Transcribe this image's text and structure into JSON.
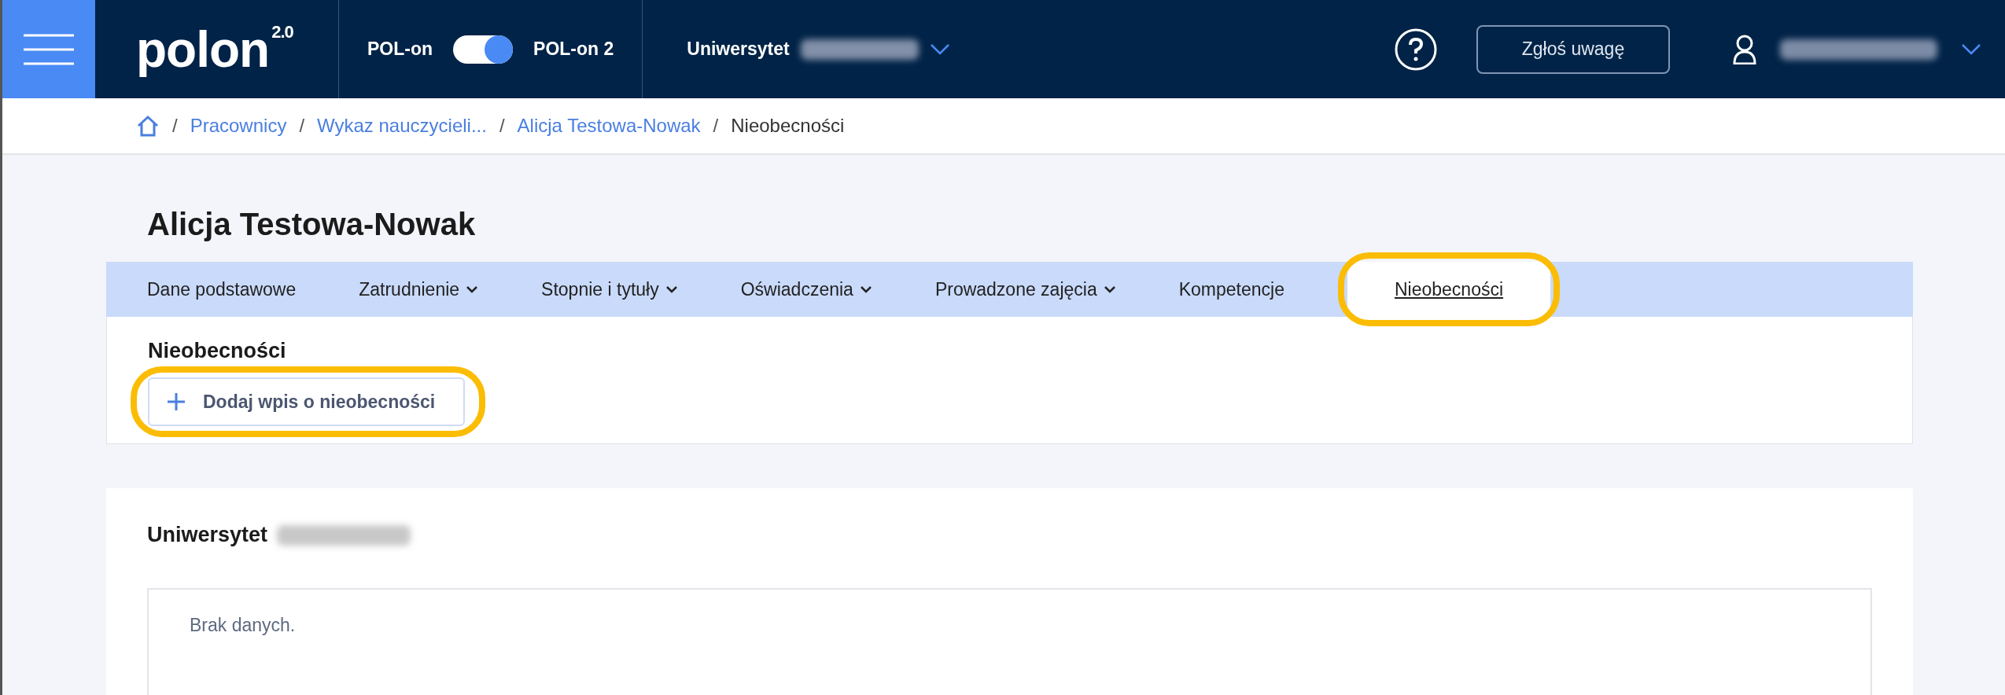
{
  "header": {
    "logo": {
      "text": "polon",
      "superscript": "2.0"
    },
    "toggle": {
      "left_label": "POL-on",
      "right_label": "POL-on 2",
      "on": true
    },
    "university": {
      "label": "Uniwersytet"
    },
    "feedback_button": "Zgłoś uwagę"
  },
  "breadcrumb": [
    {
      "separator": "/",
      "label": "Pracownicy",
      "link": true
    },
    {
      "separator": "/",
      "label": "Wykaz nauczycieli...",
      "link": true
    },
    {
      "separator": "/",
      "label": "Alicja Testowa-Nowak",
      "link": true
    },
    {
      "separator": "/",
      "label": "Nieobecności",
      "link": false
    }
  ],
  "page_title": "Alicja Testowa-Nowak",
  "tabs": [
    {
      "label": "Dane podstawowe",
      "dropdown": false,
      "selected": false
    },
    {
      "label": "Zatrudnienie",
      "dropdown": true,
      "selected": false
    },
    {
      "label": "Stopnie i tytuły",
      "dropdown": true,
      "selected": false
    },
    {
      "label": "Oświadczenia",
      "dropdown": true,
      "selected": false
    },
    {
      "label": "Prowadzone zajęcia",
      "dropdown": true,
      "selected": false
    },
    {
      "label": "Kompetencje",
      "dropdown": false,
      "selected": false
    },
    {
      "label": "Nieobecności",
      "dropdown": false,
      "selected": true,
      "highlighted": true
    }
  ],
  "section": {
    "title": "Nieobecności",
    "add_button": {
      "label": "Dodaj wpis o nieobecności",
      "highlighted": true
    }
  },
  "institution_card": {
    "title": "Uniwersytet",
    "empty_text": "Brak danych."
  }
}
